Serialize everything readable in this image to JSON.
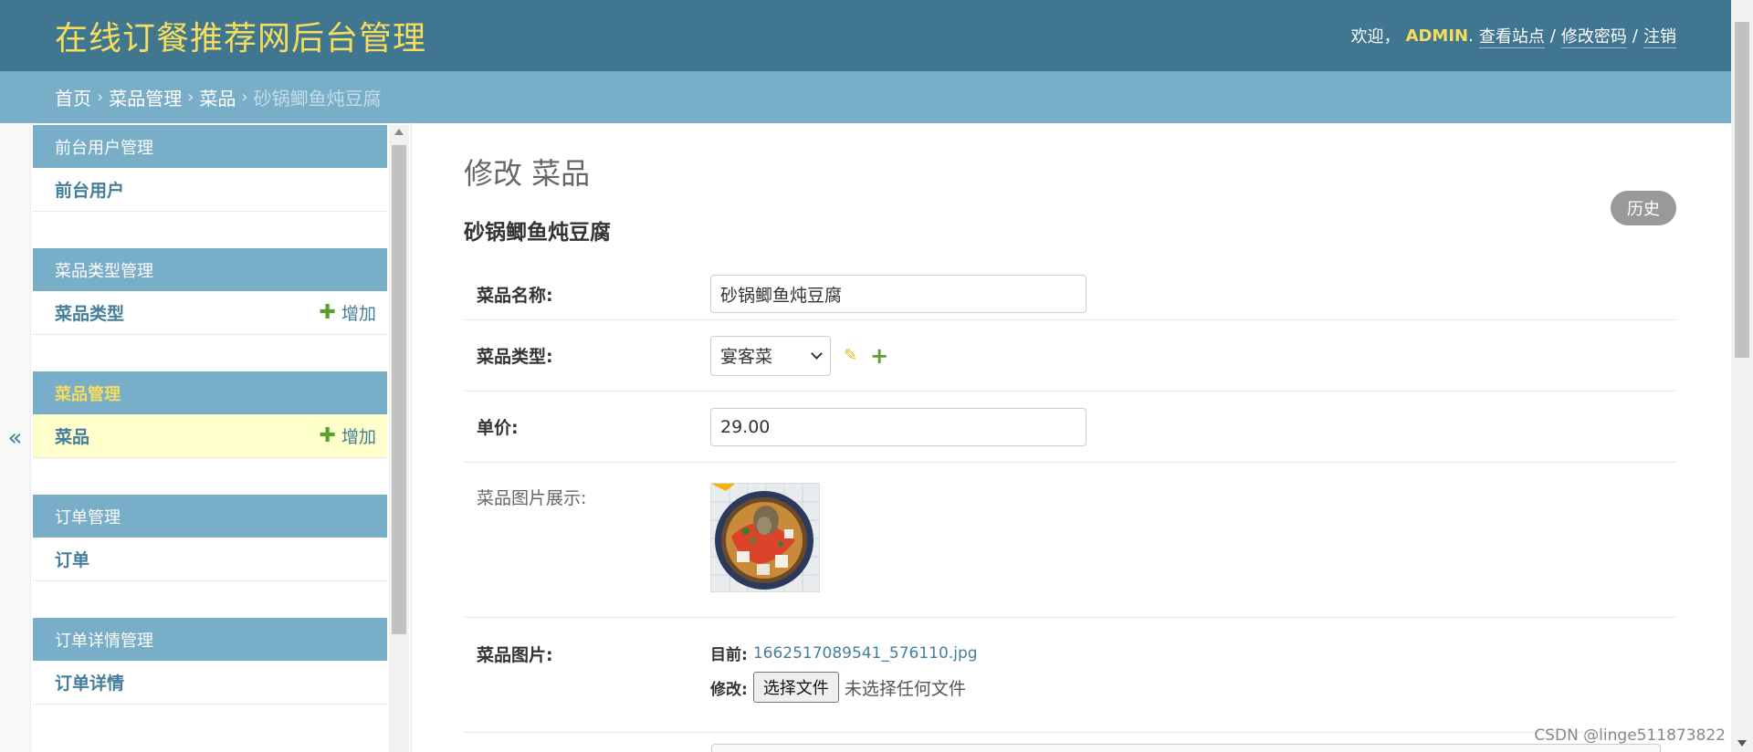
{
  "header": {
    "brand": "在线订餐推荐网后台管理",
    "welcome": "欢迎，",
    "username": "ADMIN",
    "username_suffix": ".",
    "view_site": "查看站点",
    "change_password": "修改密码",
    "logout": "注销",
    "sep": "/"
  },
  "breadcrumbs": {
    "home": "首页",
    "app": "菜品管理",
    "model": "菜品",
    "current": "砂锅鲫鱼炖豆腐",
    "sep": "›"
  },
  "nav_toggle": "«",
  "sidebar": {
    "modules": [
      {
        "caption": "前台用户管理",
        "model": "前台用户",
        "add": ""
      },
      {
        "caption": "菜品类型管理",
        "model": "菜品类型",
        "add": "增加"
      },
      {
        "caption": "菜品管理",
        "model": "菜品",
        "add": "增加"
      },
      {
        "caption": "订单管理",
        "model": "订单",
        "add": ""
      },
      {
        "caption": "订单详情管理",
        "model": "订单详情",
        "add": ""
      }
    ]
  },
  "content": {
    "page_title": "修改 菜品",
    "history": "历史",
    "object_title": "砂锅鲫鱼炖豆腐",
    "fields": {
      "name_label": "菜品名称:",
      "name_value": "砂锅鲫鱼炖豆腐",
      "type_label": "菜品类型:",
      "type_value": "宴客菜",
      "price_label": "单价:",
      "price_value": "29.00",
      "preview_label": "菜品图片展示:",
      "image_label": "菜品图片:",
      "current_label": "目前:",
      "current_file": "1662517089541_576110.jpg",
      "change_label": "修改:",
      "choose_file": "选择文件",
      "no_file": "未选择任何文件"
    }
  },
  "watermark": "CSDN @linge511873822",
  "colors": {
    "header_bg": "#417690",
    "breadcrumb_bg": "#79aec8",
    "brand": "#f5dd5d",
    "link": "#447e9b",
    "add_green": "#5aa02c",
    "current_row": "#ffffcc"
  }
}
